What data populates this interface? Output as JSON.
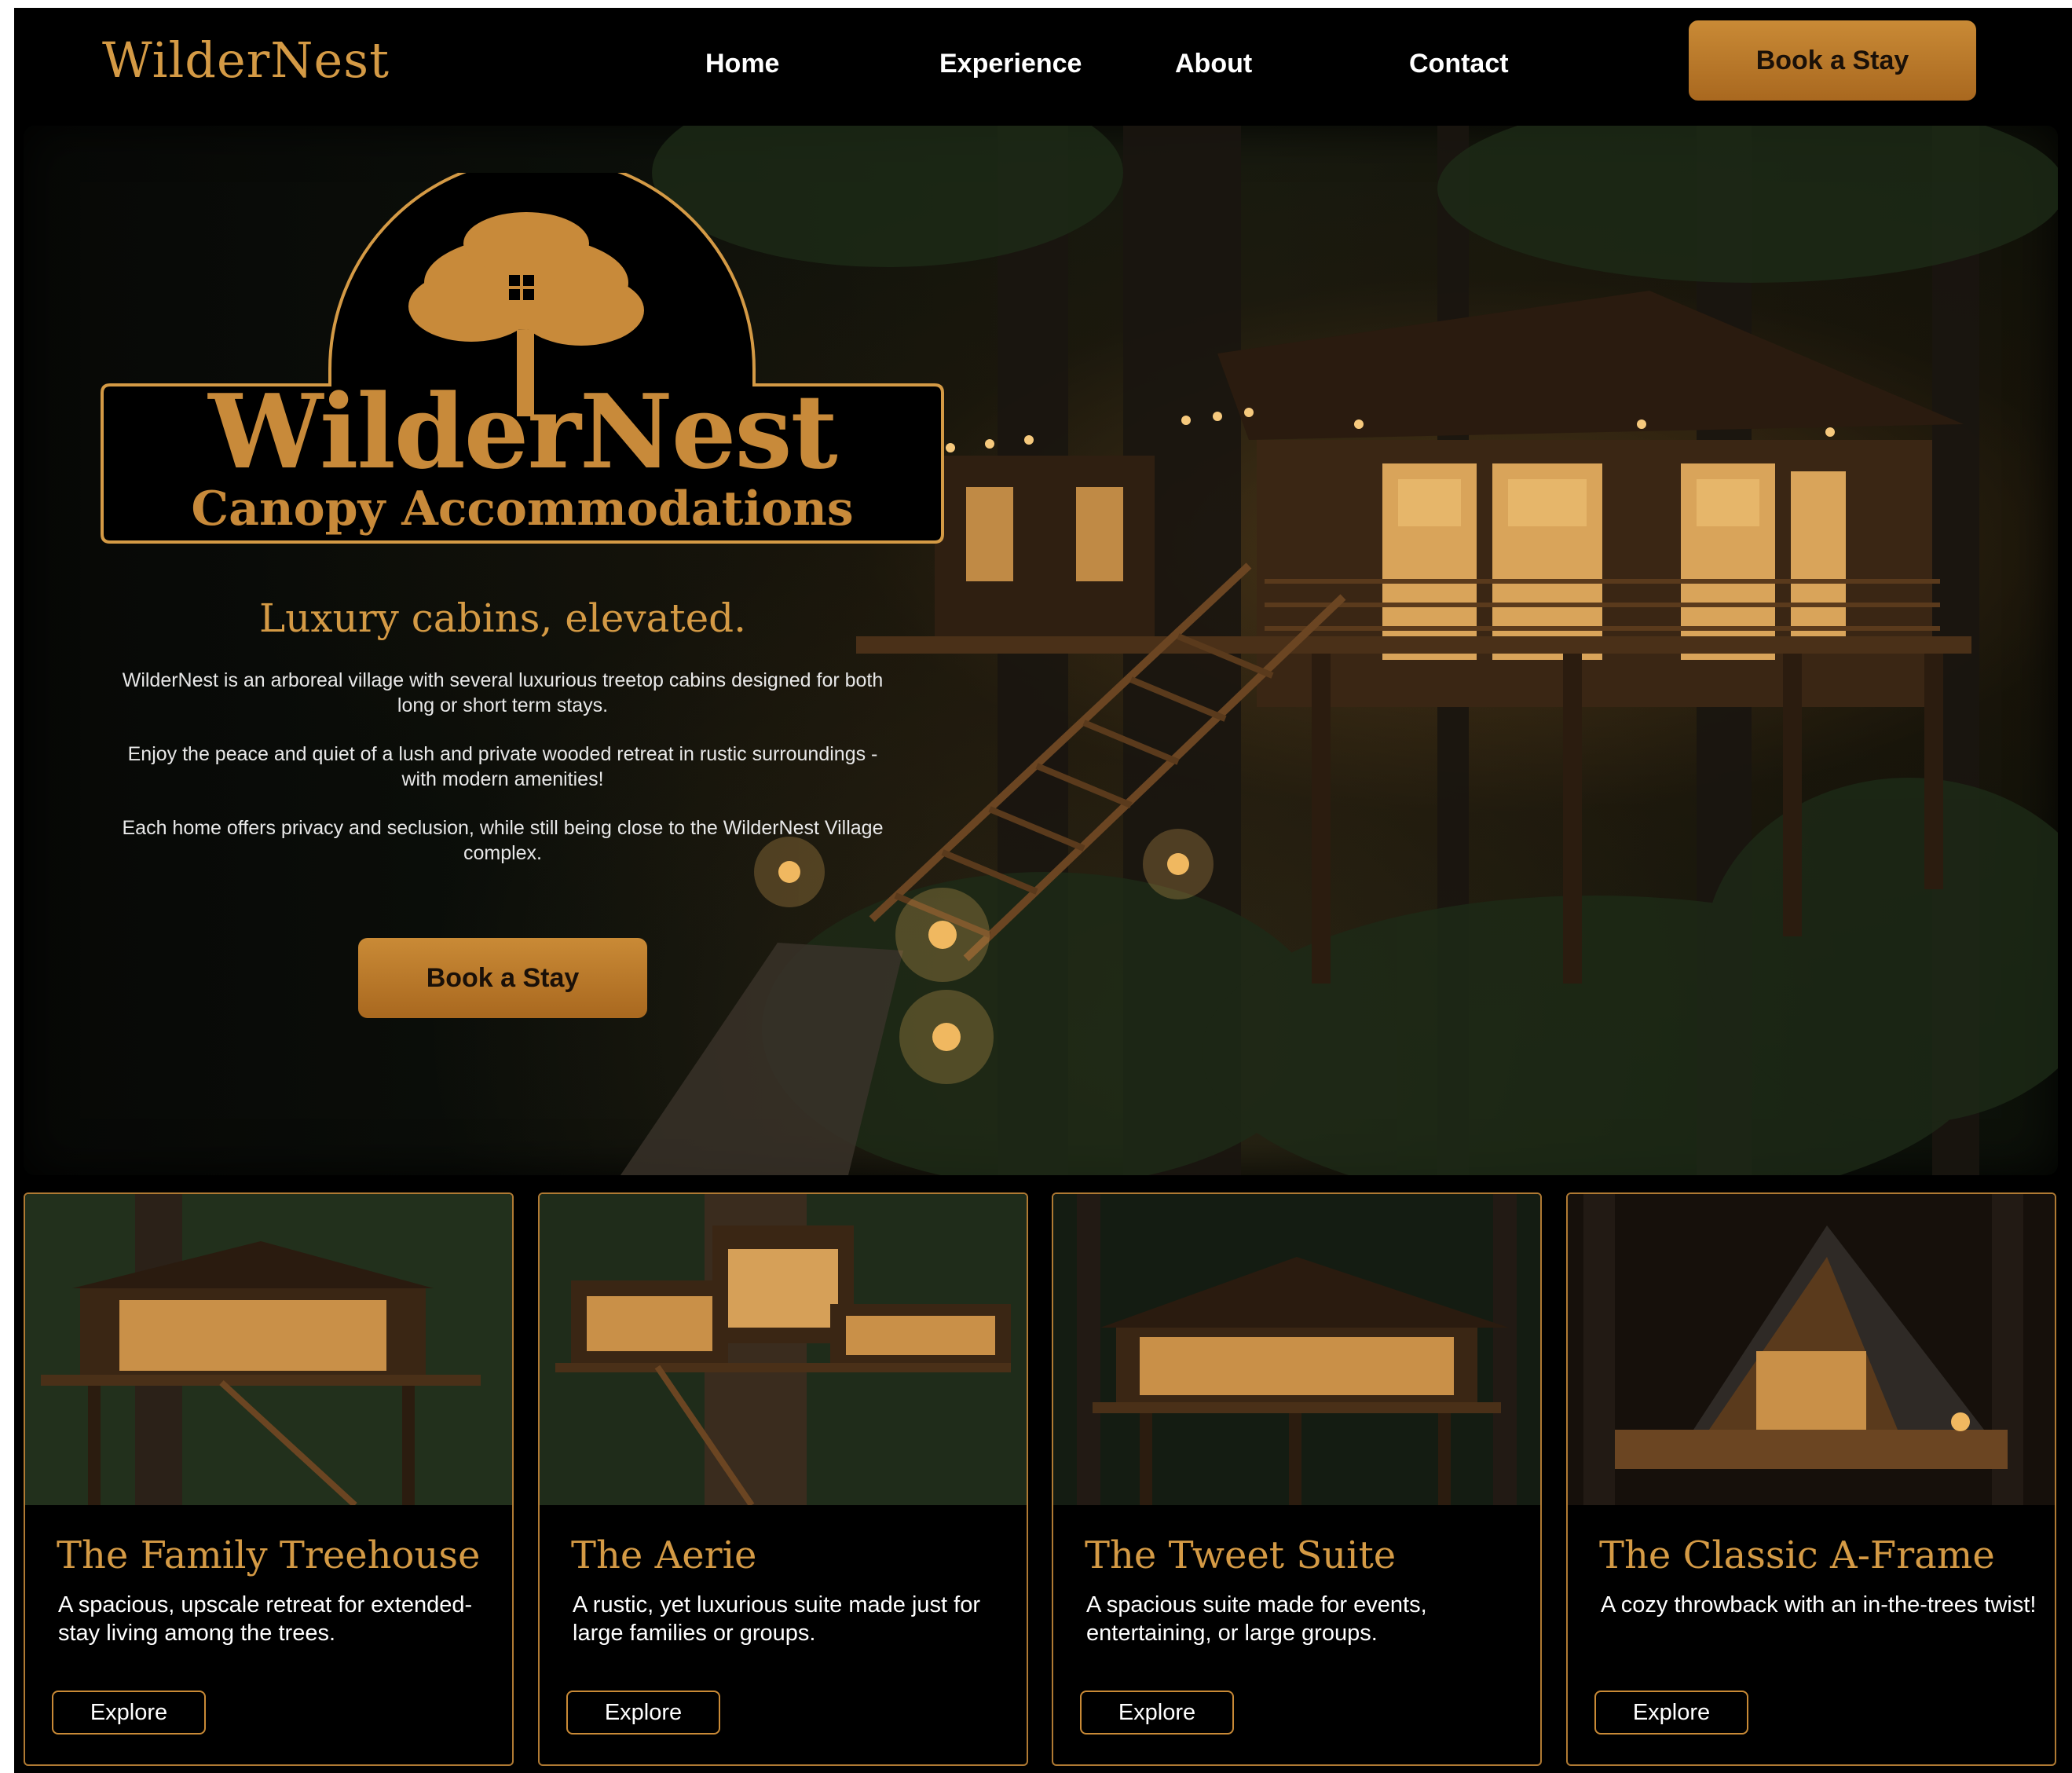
{
  "brand": "WilderNest",
  "nav": {
    "links": [
      "Home",
      "Experience",
      "About",
      "Contact"
    ],
    "cta": "Book a Stay"
  },
  "hero": {
    "logo": {
      "line1": "WilderNest",
      "line2": "Canopy Accommodations"
    },
    "tagline": "Luxury cabins, elevated.",
    "paragraphs": [
      "WilderNest is an arboreal village with several luxurious treetop cabins designed for both long or short term stays.",
      "Enjoy the peace and quiet of a lush and private wooded retreat in rustic surroundings - with modern amenities!",
      "Each home offers privacy and seclusion, while still being close to the WilderNest Village complex."
    ],
    "cta": "Book a Stay"
  },
  "cards": [
    {
      "title": "The Family Treehouse",
      "desc": "A spacious, upscale retreat for extended-stay living among the trees.",
      "button": "Explore"
    },
    {
      "title": "The Aerie",
      "desc": "A rustic, yet luxurious suite made just for large families or groups.",
      "button": "Explore"
    },
    {
      "title": "The Tweet Suite",
      "desc": "A spacious suite made for events, entertaining, or large groups.",
      "button": "Explore"
    },
    {
      "title": "The Classic A-Frame",
      "desc": "A cozy throwback with an in-the-trees twist!",
      "button": "Explore"
    }
  ],
  "colors": {
    "accent": "#d49a45",
    "button_top": "#c98a36",
    "button_bottom": "#a9681f",
    "background": "#000000"
  }
}
